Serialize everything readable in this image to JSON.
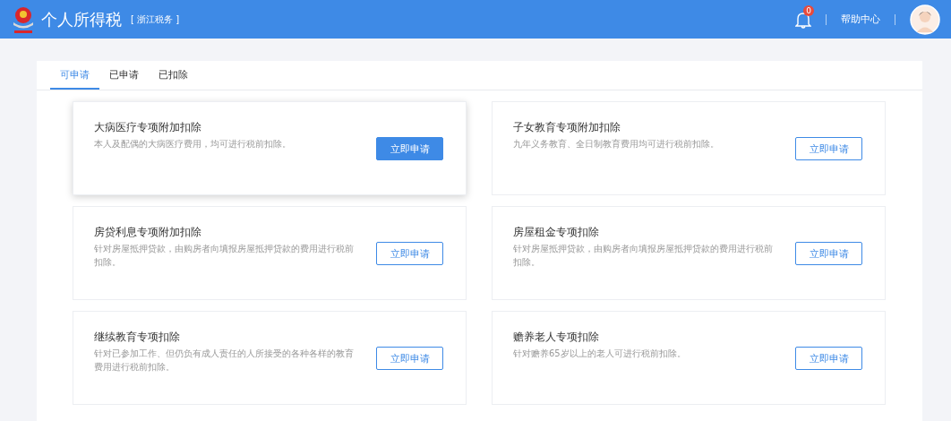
{
  "header": {
    "title": "个人所得税",
    "region": "[ 浙江税务 ]",
    "notification_count": "0",
    "help": "帮助中心"
  },
  "tabs": [
    {
      "label": "可申请",
      "selected": true
    },
    {
      "label": "已申请",
      "selected": false
    },
    {
      "label": "已扣除",
      "selected": false
    }
  ],
  "cards": [
    {
      "title": "大病医疗专项附加扣除",
      "description": "本人及配偶的大病医疗费用，均可进行税前扣除。",
      "button": "立即申请",
      "highlighted": true
    },
    {
      "title": "子女教育专项附加扣除",
      "description": "九年义务教育、全日制教育费用均可进行税前扣除。",
      "button": "立即申请",
      "highlighted": false
    },
    {
      "title": "房贷利息专项附加扣除",
      "description": "针对房屋抵押贷款，由购房者向填报房屋抵押贷款的费用进行税前扣除。",
      "button": "立即申请",
      "highlighted": false
    },
    {
      "title": "房屋租金专项扣除",
      "description": "针对房屋抵押贷款，由购房者向填报房屋抵押贷款的费用进行税前扣除。",
      "button": "立即申请",
      "highlighted": false
    },
    {
      "title": "继续教育专项扣除",
      "description": "针对已参加工作、但仍负有成人责任的人所接受的各种各样的教育费用进行税前扣除。",
      "button": "立即申请",
      "highlighted": false
    },
    {
      "title": "赡养老人专项扣除",
      "description": "针对赡养65岁以上的老人可进行税前扣除。",
      "button": "立即申请",
      "highlighted": false
    }
  ]
}
